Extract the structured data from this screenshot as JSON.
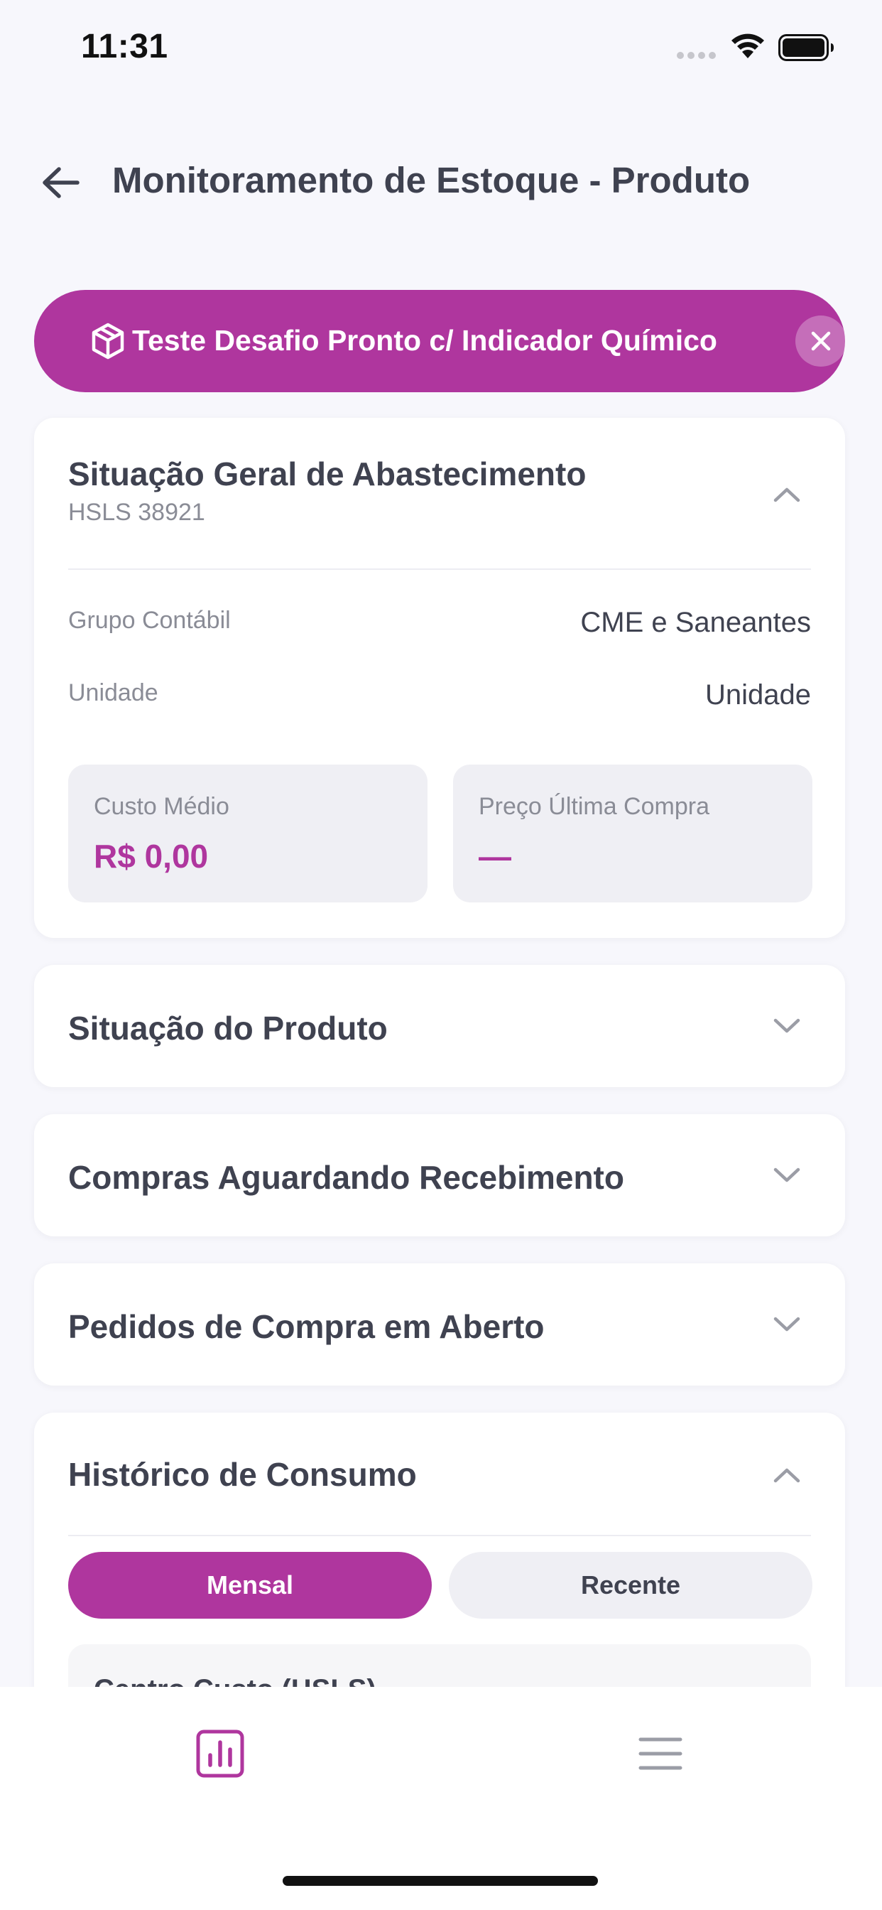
{
  "status_bar": {
    "time": "11:31"
  },
  "header": {
    "title": "Monitoramento de Estoque - Produto"
  },
  "product_chip": {
    "label": "Teste Desafio Pronto c/ Indicador Químico",
    "icon": "box-icon"
  },
  "supply_card": {
    "title": "Situação Geral de Abastecimento",
    "code": "HSLS 38921",
    "rows": [
      {
        "label": "Grupo Contábil",
        "value": "CME e Saneantes"
      },
      {
        "label": "Unidade",
        "value": "Unidade"
      }
    ],
    "stats": [
      {
        "label": "Custo Médio",
        "value": "R$ 0,00"
      },
      {
        "label": "Preço Última Compra",
        "value": "—"
      }
    ]
  },
  "sections": [
    {
      "title": "Situação do Produto"
    },
    {
      "title": "Compras Aguardando Recebimento"
    },
    {
      "title": "Pedidos de Compra em Aberto"
    }
  ],
  "history_card": {
    "title": "Histórico de Consumo",
    "tabs": [
      {
        "label": "Mensal",
        "active": true
      },
      {
        "label": "Recente",
        "active": false
      }
    ],
    "panel_title": "Centro Custo (HSLS)"
  },
  "bottom_nav": {
    "items": [
      {
        "icon": "bar-chart-icon",
        "active": true
      },
      {
        "icon": "menu-icon",
        "active": false
      }
    ]
  },
  "colors": {
    "accent": "#af369e",
    "background": "#f7f7fc",
    "text": "#3f4250",
    "muted": "#8a8c96"
  }
}
